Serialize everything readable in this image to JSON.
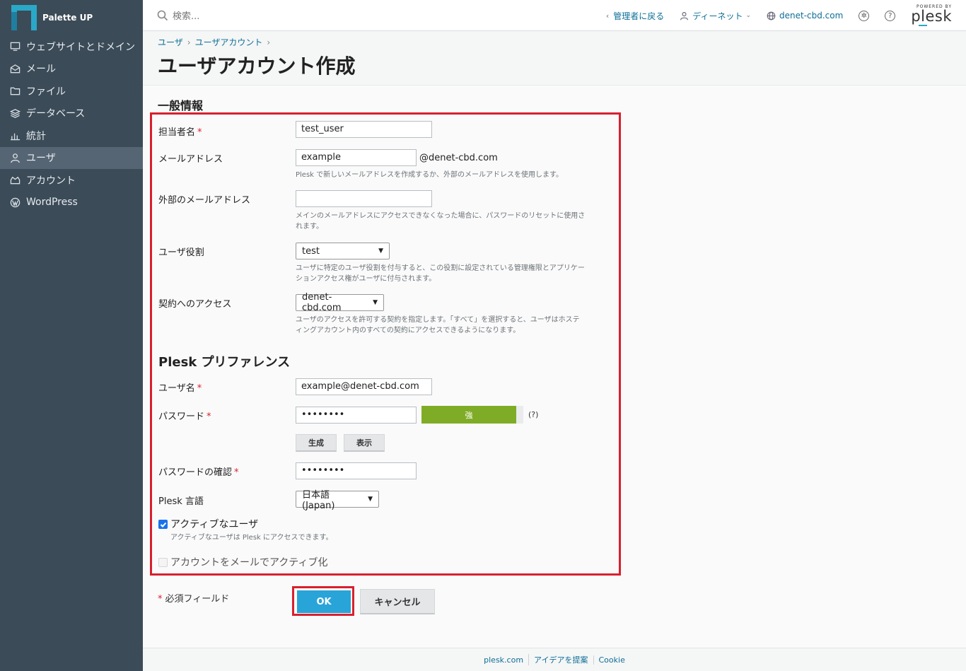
{
  "app": {
    "brand": "Palette UP"
  },
  "sidebar": {
    "items": [
      {
        "label": "ウェブサイトとドメイン",
        "icon": "monitor-icon"
      },
      {
        "label": "メール",
        "icon": "mail-icon"
      },
      {
        "label": "ファイル",
        "icon": "folder-icon"
      },
      {
        "label": "データベース",
        "icon": "database-icon"
      },
      {
        "label": "統計",
        "icon": "stats-icon"
      },
      {
        "label": "ユーザ",
        "icon": "user-icon",
        "active": true
      },
      {
        "label": "アカウント",
        "icon": "account-icon"
      },
      {
        "label": "WordPress",
        "icon": "wordpress-icon"
      }
    ]
  },
  "topbar": {
    "search_placeholder": "検索...",
    "back_to_admin": "管理者に戻る",
    "user_menu": "ディーネット",
    "domain": "denet-cbd.com",
    "powered_by": "POWERED BY",
    "plesk": "plesk"
  },
  "header": {
    "breadcrumb": [
      "ユーザ",
      "ユーザアカウント"
    ],
    "title": "ユーザアカウント作成"
  },
  "form": {
    "section_general": "一般情報",
    "contact_name_label": "担当者名",
    "contact_name_value": "test_user",
    "email_label": "メールアドレス",
    "email_value": "example",
    "email_domain": "@denet-cbd.com",
    "email_hint": "Plesk で新しいメールアドレスを作成するか、外部のメールアドレスを使用します。",
    "ext_email_label": "外部のメールアドレス",
    "ext_email_value": "",
    "ext_email_hint_1": "メインのメールアドレスにアクセスできなくなった場合に、パスワードのリセットに使用さ",
    "ext_email_hint_2": "れます。",
    "role_label": "ユーザ役割",
    "role_value": "test",
    "role_hint_1": "ユーザに特定のユーザ役割を付与すると、この役割に設定されている管理権限とアプリケー",
    "role_hint_2": "ションアクセス権がユーザに付与されます。",
    "subscription_label": "契約へのアクセス",
    "subscription_value": "denet-cbd.com",
    "subscription_hint_1": "ユーザのアクセスを許可する契約を指定します。「すべて」を選択すると、ユーザはホステ",
    "subscription_hint_2": "ィングアカウント内のすべての契約にアクセスできるようになります。",
    "section_plesk": "Plesk プリファレンス",
    "username_label": "ユーザ名",
    "username_value": "example@denet-cbd.com",
    "password_label": "パスワード",
    "password_value": "••••••••",
    "strength_label": "強",
    "strength_help": "(?)",
    "generate_button": "生成",
    "show_button": "表示",
    "confirm_label": "パスワードの確認",
    "confirm_value": "••••••••",
    "language_label": "Plesk 言語",
    "language_value": "日本語 (Japan)",
    "active_label": "アクティブなユーザ",
    "active_checked": true,
    "active_hint": "アクティブなユーザは Plesk にアクセスできます。",
    "activate_mail_label": "アカウントをメールでアクティブ化",
    "activate_mail_checked": false,
    "required_marker": "*",
    "required_note": "必須フィールド",
    "ok_button": "OK",
    "cancel_button": "キャンセル"
  },
  "footer": {
    "links": [
      "plesk.com",
      "アイデアを提案",
      "Cookie"
    ]
  },
  "colors": {
    "sidebar_bg": "#3b4b58",
    "accent": "#29a4d8",
    "highlight_frame": "#d8202e",
    "strength_good": "#7fac26"
  }
}
